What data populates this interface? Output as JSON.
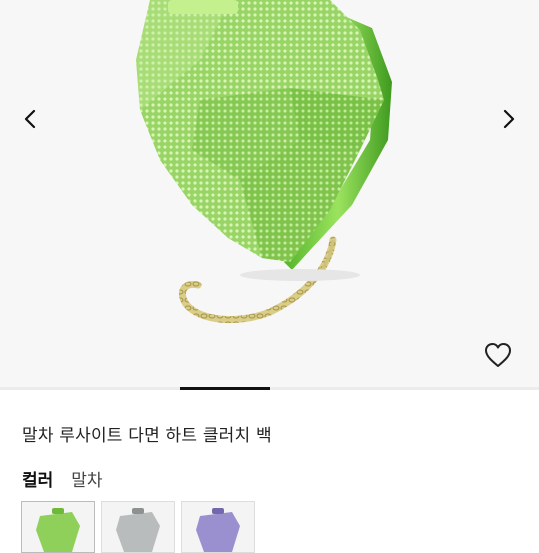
{
  "product": {
    "title": "말차 루사이트 다면 하트 클러치 백",
    "color_label": "컬러",
    "color_value": "말차"
  },
  "gallery": {
    "image_icon": "green-crystal-heart-clutch-image",
    "prev_icon": "chevron-left-icon",
    "next_icon": "chevron-right-icon",
    "wishlist_icon": "heart-outline-icon"
  },
  "swatches": [
    {
      "name": "green",
      "color": "#8fd05a"
    },
    {
      "name": "silver",
      "color": "#b9bcbc"
    },
    {
      "name": "lavender",
      "color": "#9a8fcf"
    }
  ],
  "colors": {
    "crystal_green": "#9fd86a",
    "crystal_green_dark": "#6fb83a",
    "chain_gold": "#cfc27a"
  }
}
